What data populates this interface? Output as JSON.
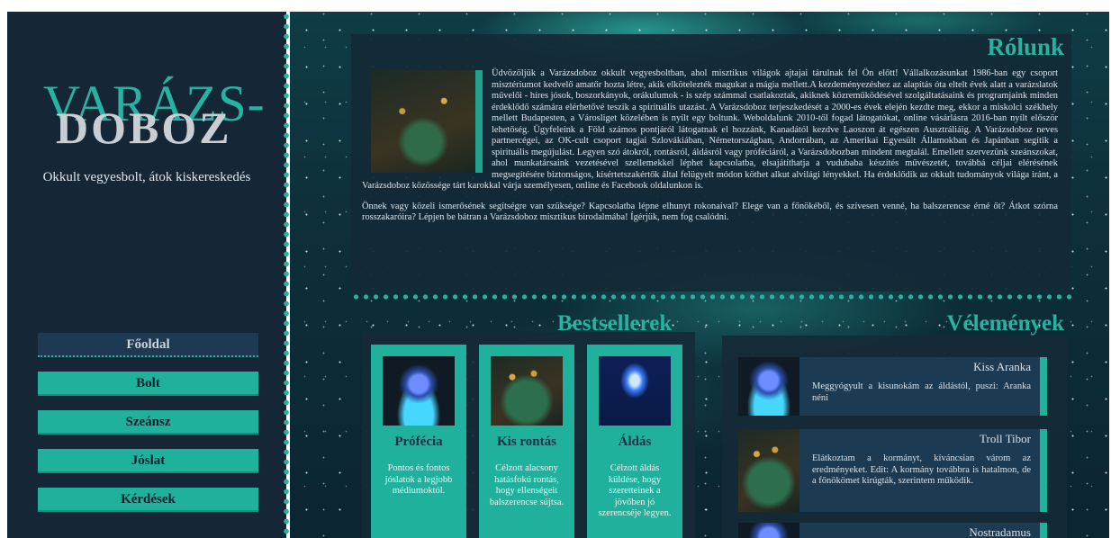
{
  "brand": {
    "logo_line1": "VARÁZS-",
    "logo_line2": "DOBOZ",
    "tagline": "Okkult vegyesbolt, átok kiskereskedés"
  },
  "nav": {
    "items": [
      {
        "label": "Főoldal",
        "active": true
      },
      {
        "label": "Bolt"
      },
      {
        "label": "Szeánsz"
      },
      {
        "label": "Jóslat"
      },
      {
        "label": "Kérdések"
      }
    ]
  },
  "about": {
    "title": "Rólunk",
    "paragraph1": "Üdvözöljük a Varázsdoboz okkult vegyesboltban, ahol misztikus világok ajtajai tárulnak fel Ön előtt! Vállalkozásunkat 1986-ban egy csoport misztériumot kedvelő amatőr hozta létre, akik elkötelezték magukat a mágia mellett.A kezdeményezéshez az alapítás óta eltelt évek alatt a varázslatok művelői - híres jósok, boszorkányok, orákulumok - is szép számmal csatlakoztak, akiknek közreműködésével szolgáltatásaink és programjaink minden érdeklődő számára elérhetővé teszik a spirituális utazást. A Varázsdoboz terjeszkedését a 2000-es évek elején kezdte meg, ekkor a miskolci székhely mellett Budapesten, a Városliget közelében is nyílt egy boltunk. Weboldalunk 2010-től fogad látogatókat, online vásárlásra 2016-ban nyílt először lehetőség. Ügyfeleink a Föld számos pontjáról látogatnak el hozzánk, Kanadától kezdve Laoszon át egészen Ausztráliáig. A Varázsdoboz neves partnercégei, az OK-cult csoport tagjai Szlovákiában, Németországban, Andorrában, az Amerikai Egyesült Államokban és Japánban segítik a spirituális megújulást. Legyen szó átokról, rontásról, áldásról vagy próféciáról, a Varázsdobozban mindent megtalál. Emellett szervezünk szeánszokat, ahol munkatársaink vezetésével szellemekkel léphet kapcsolatba, elsajátíthatja a vudubaba készítés művészetét, továbbá céljai elérésének megsegítésére biztonságos, kísértetszakértők által felügyelt módon köthet alkut alvilági lényekkel. Ha érdeklődik az okkult tudományok világa iránt, a Varázsdoboz közössége tárt karokkal várja személyesen, online és Facebook oldalunkon is.",
    "paragraph2": "Önnek vagy közeli ismerősének segítségre van szüksége? Kapcsolatba lépne elhunyt rokonaival? Elege van a főnökéből, és szívesen venné, ha balszerencse érné őt? Átkot szórna rosszakaróira? Lépjen be bátran a Varázsdoboz misztikus birodalmába! Ígérjük, nem fog csalódni."
  },
  "bestsellers": {
    "title": "Bestsellerek",
    "items": [
      {
        "title": "Prófécia",
        "desc": "Pontos és fontos jóslatok a legjobb médiumoktól.",
        "image": "crystal-orb-image"
      },
      {
        "title": "Kis rontás",
        "desc": "Célzott alacsony hatásfokú rontás, hogy ellenségeit balszerencse sújtsa.",
        "image": "candle-table-image"
      },
      {
        "title": "Áldás",
        "desc": "Célzott áldás küldése, hogy szeretteinek a jövőben jó szerencséje legyen.",
        "image": "blue-candle-image"
      }
    ]
  },
  "reviews": {
    "title": "Vélemények",
    "items": [
      {
        "name": "Kiss Aranka",
        "text": "Meggyógyult a kisunokám az áldástól, puszi: Aranka néni"
      },
      {
        "name": "Troll Tibor",
        "text": "Elátkoztam a kormányt, kíváncsian várom az eredményeket. Edit: A kormány továbbra is hatalmon, de a főnökömet kirúgták, szerintem működik."
      },
      {
        "name": "Nostradamus",
        "text": ""
      }
    ]
  },
  "colors": {
    "accent": "#20b19d",
    "sidebar_bg": "#152637",
    "panel_bg": "#1c3a52"
  }
}
